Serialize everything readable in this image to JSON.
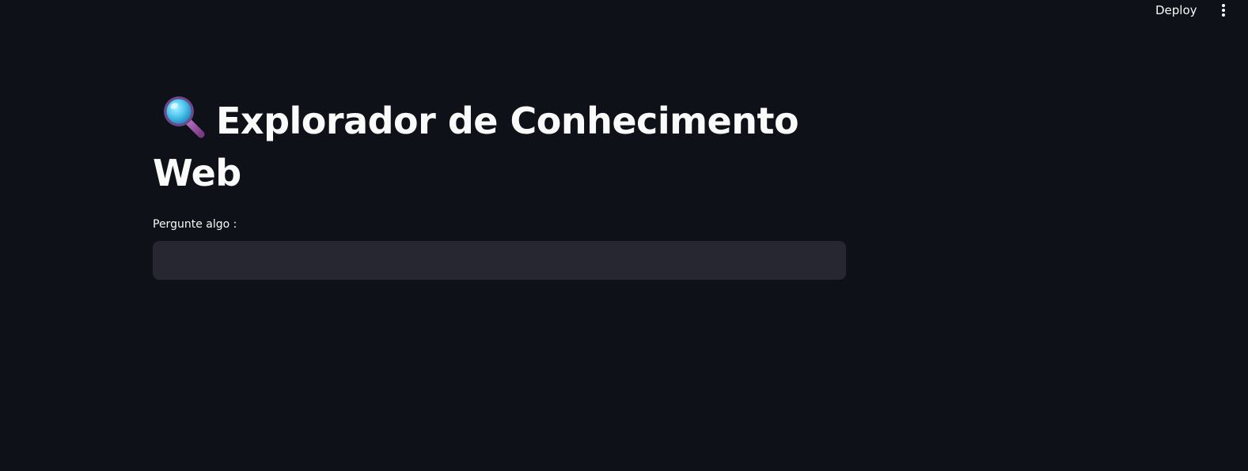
{
  "header": {
    "deploy_label": "Deploy",
    "menu_icon": "vertical-ellipsis-icon"
  },
  "main": {
    "title_icon": "magnifying-glass-icon",
    "title": "Explorador de Conhecimento Web",
    "input": {
      "label": "Pergunte algo :",
      "value": "",
      "placeholder": ""
    }
  },
  "colors": {
    "background": "#0e1117",
    "input_background": "#262730",
    "text": "#fafafa"
  }
}
